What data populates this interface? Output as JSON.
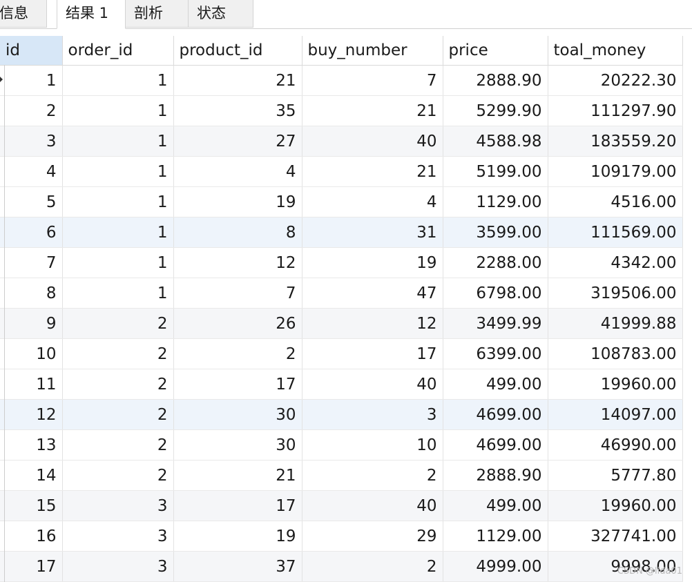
{
  "tabs": [
    {
      "label": "信息",
      "active": false
    },
    {
      "label": "结果 1",
      "active": true
    },
    {
      "label": "剖析",
      "active": false
    },
    {
      "label": "状态",
      "active": false
    }
  ],
  "columns": [
    "id",
    "order_id",
    "product_id",
    "buy_number",
    "price",
    "toal_money"
  ],
  "rows": [
    [
      "1",
      "1",
      "21",
      "7",
      "2888.90",
      "20222.30"
    ],
    [
      "2",
      "1",
      "35",
      "21",
      "5299.90",
      "111297.90"
    ],
    [
      "3",
      "1",
      "27",
      "40",
      "4588.98",
      "183559.20"
    ],
    [
      "4",
      "1",
      "4",
      "21",
      "5199.00",
      "109179.00"
    ],
    [
      "5",
      "1",
      "19",
      "4",
      "1129.00",
      "4516.00"
    ],
    [
      "6",
      "1",
      "8",
      "31",
      "3599.00",
      "111569.00"
    ],
    [
      "7",
      "1",
      "12",
      "19",
      "2288.00",
      "4342.00"
    ],
    [
      "8",
      "1",
      "7",
      "47",
      "6798.00",
      "319506.00"
    ],
    [
      "9",
      "2",
      "26",
      "12",
      "3499.99",
      "41999.88"
    ],
    [
      "10",
      "2",
      "2",
      "17",
      "6399.00",
      "108783.00"
    ],
    [
      "11",
      "2",
      "17",
      "40",
      "499.00",
      "19960.00"
    ],
    [
      "12",
      "2",
      "30",
      "3",
      "4699.00",
      "14097.00"
    ],
    [
      "13",
      "2",
      "30",
      "10",
      "4699.00",
      "46990.00"
    ],
    [
      "14",
      "2",
      "21",
      "2",
      "2888.90",
      "5777.80"
    ],
    [
      "15",
      "3",
      "17",
      "40",
      "499.00",
      "19960.00"
    ],
    [
      "16",
      "3",
      "19",
      "29",
      "1129.00",
      "327741.00"
    ],
    [
      "17",
      "3",
      "37",
      "2",
      "4999.00",
      "9998.00"
    ]
  ],
  "watermark": "CSDN @lida01"
}
